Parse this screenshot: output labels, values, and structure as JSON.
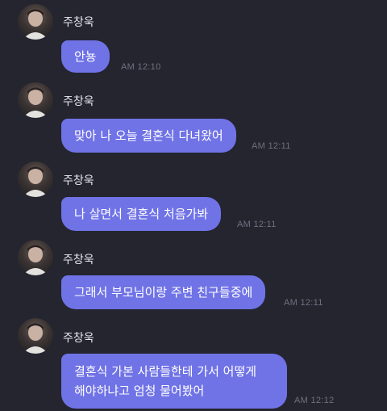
{
  "chat": {
    "messages": [
      {
        "sender": "주창욱",
        "text": "안뇽",
        "time": "AM 12:10"
      },
      {
        "sender": "주창욱",
        "text": "맞아 나 오늘 결혼식 다녀왔어",
        "time": "AM 12:11"
      },
      {
        "sender": "주창욱",
        "text": "나 살면서 결혼식 처음가봐",
        "time": "AM 12:11"
      },
      {
        "sender": "주창욱",
        "text": "그래서 부모님이랑 주변 친구들중에",
        "time": "AM 12:11"
      },
      {
        "sender": "주창욱",
        "text_line1": "결혼식 가본 사람들한테 가서 어떻게",
        "text_line2": "해야하냐고 엄청 물어봤어",
        "time": "AM 12:12"
      }
    ]
  },
  "colors": {
    "background": "#24252f",
    "bubble": "#7073e6",
    "time_text": "#6f7180",
    "sender_text": "#e9e9ee"
  }
}
